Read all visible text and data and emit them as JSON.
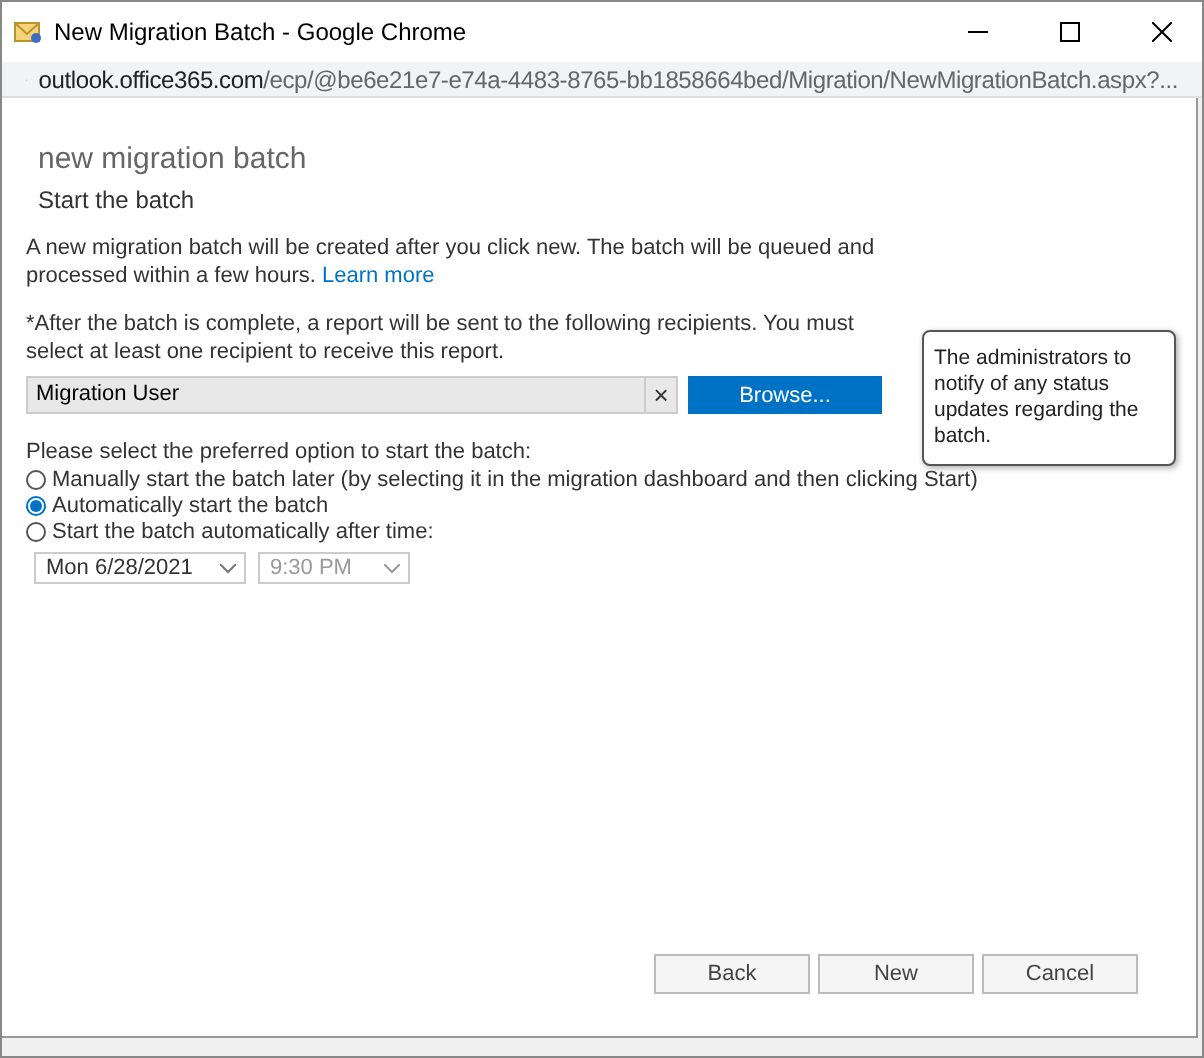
{
  "window": {
    "title": "New Migration Batch - Google Chrome"
  },
  "address_bar": {
    "host": "outlook.office365.com",
    "path": "/ecp/@be6e21e7-e74a-4483-8765-bb1858664bed/Migration/NewMigrationBatch.aspx?..."
  },
  "page": {
    "title": "new migration batch",
    "subtitle": "Start the batch"
  },
  "intro": {
    "text": "A new migration batch will be created after you click new. The batch will be queued and processed within a few hours.",
    "link": "Learn more"
  },
  "recipients": {
    "label": "*After the batch is complete, a report will be sent to the following recipients. You must select at least one recipient to receive this report.",
    "value": "Migration User",
    "clear": "×",
    "browse": "Browse..."
  },
  "tooltip": {
    "text": "The administrators to notify of any status updates regarding the batch."
  },
  "start_options": {
    "label": "Please select the preferred option to start the batch:",
    "options": [
      {
        "label": "Manually start the batch later (by selecting it in the migration dashboard and then clicking Start)",
        "selected": false
      },
      {
        "label": "Automatically start the batch",
        "selected": true
      },
      {
        "label": "Start the batch automatically after time:",
        "selected": false
      }
    ]
  },
  "schedule": {
    "date": {
      "value": "Mon 6/28/2021",
      "disabled": false
    },
    "time": {
      "value": "9:30 PM",
      "disabled": true
    }
  },
  "buttons": [
    {
      "label": "Back"
    },
    {
      "label": "New"
    },
    {
      "label": "Cancel"
    }
  ]
}
